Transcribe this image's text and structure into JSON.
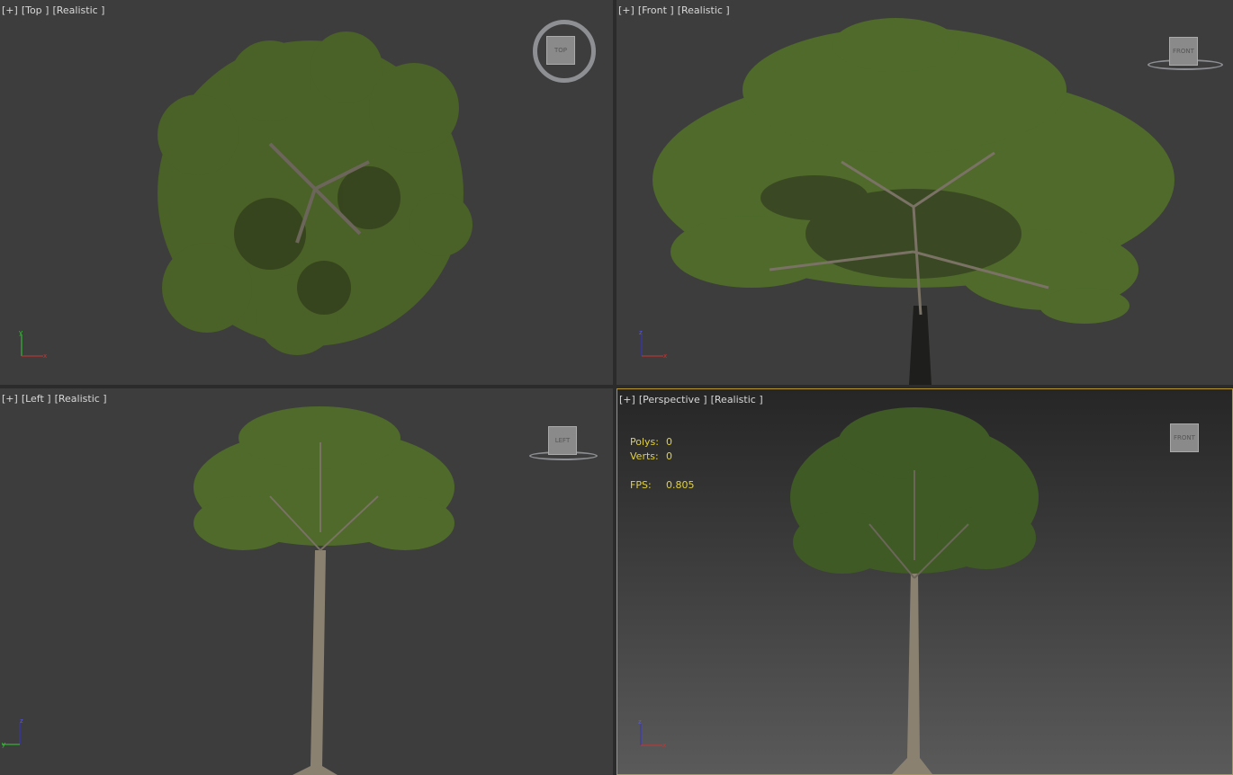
{
  "viewports": [
    {
      "id": "top",
      "labels": [
        "[+]",
        "[Top ]",
        "[Realistic ]"
      ],
      "viewcube": "TOP",
      "axes": [
        "y",
        "x"
      ]
    },
    {
      "id": "front",
      "labels": [
        "[+]",
        "[Front ]",
        "[Realistic ]"
      ],
      "viewcube": "FRONT",
      "axes": [
        "z",
        "x"
      ]
    },
    {
      "id": "left",
      "labels": [
        "[+]",
        "[Left ]",
        "[Realistic ]"
      ],
      "viewcube": "LEFT",
      "axes": [
        "z",
        "y"
      ]
    },
    {
      "id": "perspective",
      "labels": [
        "[+]",
        "[Perspective ]",
        "[Realistic ]"
      ],
      "viewcube": "FRONT",
      "axes": [
        "z",
        "x"
      ],
      "active": true,
      "stats": {
        "polys_label": "Polys:",
        "polys": "0",
        "verts_label": "Verts:",
        "verts": "0",
        "fps_label": "FPS:",
        "fps": "0.805"
      }
    }
  ],
  "colors": {
    "active_border": "#b8972e",
    "stats_text": "#e3d23c",
    "foliage": "#4f6a2a"
  }
}
